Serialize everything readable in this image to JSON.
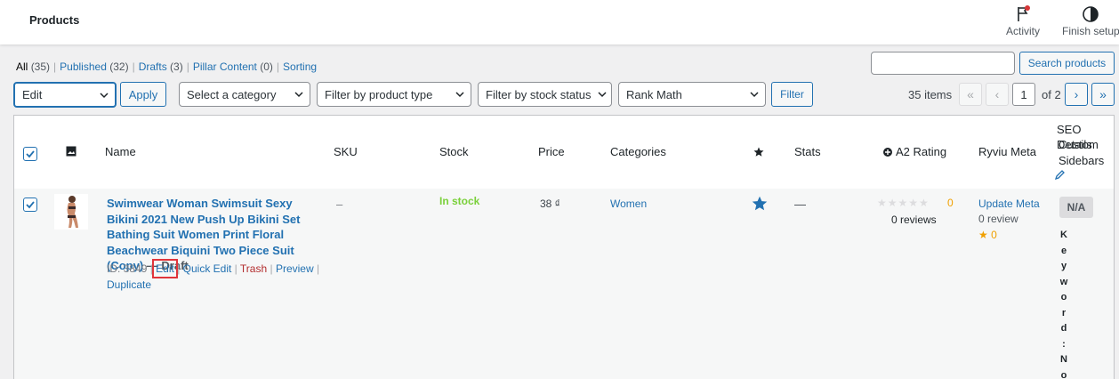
{
  "topbar": {
    "title": "Products",
    "activity_label": "Activity",
    "finish_setup_label": "Finish setup"
  },
  "views": [
    {
      "label": "All",
      "count": "(35)"
    },
    {
      "label": "Published",
      "count": "(32)"
    },
    {
      "label": "Drafts",
      "count": "(3)"
    },
    {
      "label": "Pillar Content",
      "count": "(0)"
    },
    {
      "label": "Sorting",
      "count": ""
    }
  ],
  "search": {
    "value": "",
    "button_label": "Search products"
  },
  "filters": {
    "bulk_action": "Edit",
    "apply_label": "Apply",
    "category": "Select a category",
    "product_type": "Filter by product type",
    "stock_status": "Filter by stock status",
    "rank_math": "Rank Math",
    "filter_label": "Filter"
  },
  "pagination": {
    "items": "35 items",
    "first": "«",
    "prev": "‹",
    "current_page": "1",
    "of_total": "of 2",
    "next": "›",
    "last": "»"
  },
  "columns": {
    "name": "Name",
    "sku": "SKU",
    "stock": "Stock",
    "price": "Price",
    "categories": "Categories",
    "stats": "Stats",
    "a2_rating": "A2 Rating",
    "ryviu_meta": "Ryviu Meta",
    "seo": "SEO",
    "custom_sidebars": "Custom Sidebars",
    "details": "Details"
  },
  "row": {
    "name": "Swimwear Woman Swimsuit Sexy Bikini 2021 New Push Up Bikini Set Bathing Suit Women Print Floral Beachwear Biquini Two Piece Suit (Copy)",
    "state": "— Draft",
    "id": "ID: 3849",
    "actions": {
      "edit": "Edit",
      "quick_edit": "Quick Edit",
      "trash": "Trash",
      "preview": "Preview",
      "duplicate": "Duplicate"
    },
    "sku": "–",
    "stock": "In stock",
    "price": "38 ₫",
    "category": "Women",
    "stats": "—",
    "a2_rating_value": "0",
    "a2_reviews": "0 reviews",
    "ryviu_update": "Update Meta",
    "ryviu_review": "0 review",
    "ryviu_star": "★ 0",
    "seo_score": "N/A",
    "keyword_vertical": [
      "K",
      "e",
      "y",
      "w",
      "o",
      "r",
      "d",
      ":",
      "N",
      "o"
    ]
  },
  "colors": {
    "link": "#2271b1",
    "in_stock": "#7ad03a",
    "trash": "#b32d2e",
    "rating_orange": "#f0a000",
    "highlight": "#e0353b"
  }
}
